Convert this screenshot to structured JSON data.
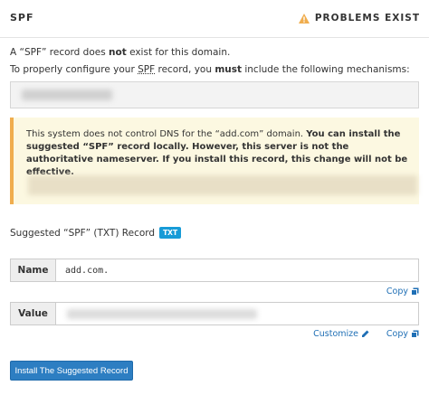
{
  "header": {
    "title": "SPF",
    "status": "PROBLEMS EXIST",
    "status_icon": "warning-icon",
    "status_color": "#f0ad4e"
  },
  "intro": {
    "line1_prefix": "A “SPF” record does ",
    "line1_bold": "not",
    "line1_suffix": " exist for this domain.",
    "line2_prefix": "To properly configure your ",
    "line2_term": "SPF",
    "line2_middle": " record, you ",
    "line2_bold": "must",
    "line2_suffix": " include the following mechanisms:"
  },
  "alert": {
    "text_normal": "This system does not control DNS for the “add.com” domain. ",
    "text_bold": "You can install the suggested “SPF” record locally. However, this server is not the authoritative nameserver. If you install this record, this change will not be effective."
  },
  "suggested": {
    "label": "Suggested “SPF” (TXT) Record",
    "badge": "TXT",
    "badge_color": "#179bd7"
  },
  "name_field": {
    "label": "Name",
    "value": "add.com."
  },
  "value_field": {
    "label": "Value"
  },
  "links": {
    "copy": "Copy",
    "customize": "Customize"
  },
  "install_button": "Install The Suggested Record",
  "accent_color": "#2d7ec2"
}
